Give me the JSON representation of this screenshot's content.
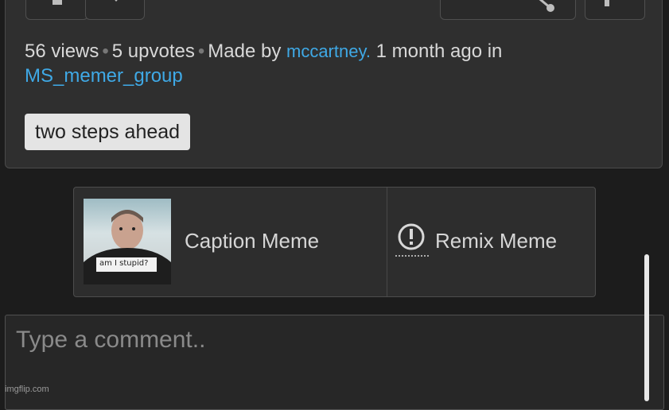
{
  "post": {
    "share_label": "share",
    "views": "56 views",
    "upvotes": "5 upvotes",
    "made_by_prefix": "Made by",
    "author": "mccartney.",
    "time": "1 month ago in",
    "group": "MS_memer_group",
    "tag": "two steps ahead"
  },
  "generators": {
    "caption_label": "Caption Meme",
    "remix_label": "Remix Meme"
  },
  "comment": {
    "placeholder": "Type a comment.."
  },
  "thumbnail": {
    "shirt_text": "am I stupid?"
  },
  "footer": {
    "watermark": "imgflip.com"
  },
  "colors": {
    "link": "#3fa9e6",
    "background": "#1c1c1c",
    "card": "#2f2f2f"
  }
}
